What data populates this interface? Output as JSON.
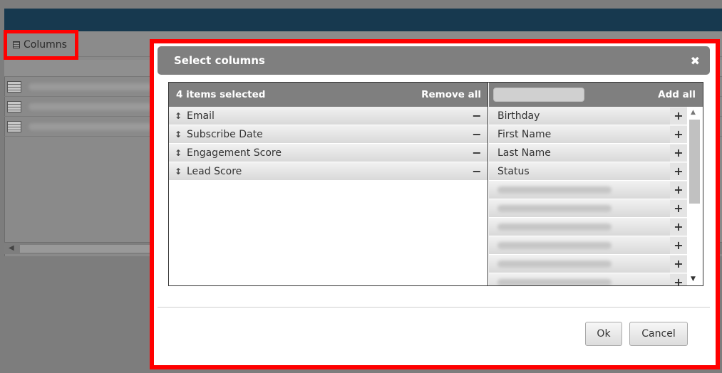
{
  "app": {
    "columns_button_label": "Columns"
  },
  "dialog": {
    "title": "Select columns",
    "close_glyph": "✖",
    "selected_pane": {
      "count_label": "4 items selected",
      "remove_all_label": "Remove all",
      "items": [
        {
          "label": "Email"
        },
        {
          "label": "Subscribe Date"
        },
        {
          "label": "Engagement Score"
        },
        {
          "label": "Lead Score"
        }
      ]
    },
    "available_pane": {
      "search_value": "",
      "add_all_label": "Add all",
      "items": [
        {
          "label": "Birthday"
        },
        {
          "label": "First Name"
        },
        {
          "label": "Last Name"
        },
        {
          "label": "Status"
        }
      ]
    },
    "ok_label": "Ok",
    "cancel_label": "Cancel"
  },
  "icons": {
    "drag": "↕",
    "remove": "−",
    "add": "+"
  },
  "colors": {
    "highlight": "#ff0000",
    "dialog_header": "#7f7f7f",
    "app_topbar": "#17394f"
  }
}
